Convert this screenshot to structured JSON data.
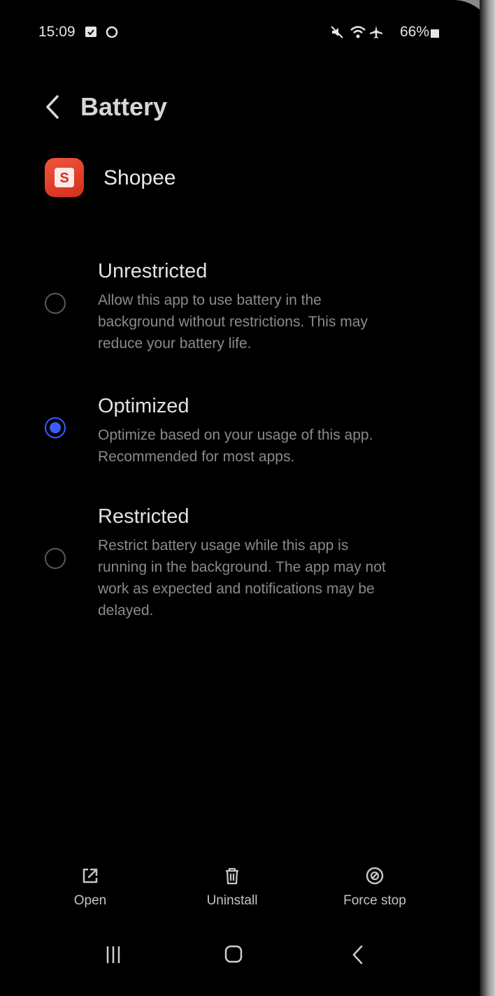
{
  "status_bar": {
    "time": "15:09",
    "battery": "66%"
  },
  "header": {
    "title": "Battery"
  },
  "app": {
    "name": "Shopee",
    "icon_letter": "S"
  },
  "options": [
    {
      "title": "Unrestricted",
      "description": "Allow this app to use battery in the background without restrictions. This may reduce your battery life.",
      "selected": false
    },
    {
      "title": "Optimized",
      "description": "Optimize based on your usage of this app. Recommended for most apps.",
      "selected": true
    },
    {
      "title": "Restricted",
      "description": "Restrict battery usage while this app is running in the background. The app may not work as expected and notifications may be delayed.",
      "selected": false
    }
  ],
  "actions": {
    "open": "Open",
    "uninstall": "Uninstall",
    "force_stop": "Force stop"
  },
  "colors": {
    "accent": "#3b5cff",
    "brand": "#e8432c"
  }
}
